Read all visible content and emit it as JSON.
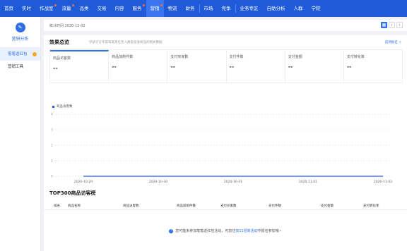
{
  "topnav": {
    "items": [
      {
        "label": "首页"
      },
      {
        "label": "实时"
      },
      {
        "label": "作战室",
        "dot": true
      },
      {
        "label": "流量",
        "dot": true
      },
      {
        "label": "品类"
      },
      {
        "label": "交易"
      },
      {
        "label": "内容"
      },
      {
        "label": "服务",
        "dot": true
      },
      {
        "label": "营销",
        "dot": true,
        "active": true
      },
      {
        "label": "物流"
      },
      {
        "label": "财务"
      },
      {
        "label": "市场"
      },
      {
        "label": "竞争"
      },
      {
        "label": "业务专区"
      },
      {
        "label": "自助分析"
      },
      {
        "label": "人群"
      },
      {
        "label": "学院"
      }
    ]
  },
  "sidebar": {
    "title": "营销分析",
    "items": [
      {
        "label": "笔笔返红包",
        "active": true
      },
      {
        "label": "营销工具"
      }
    ]
  },
  "datebar": {
    "text": "统计时间 2020-11-02"
  },
  "effect": {
    "title": "效果总览",
    "subtitle": "仅统计订作前笔笔现任务人群及投放商品的相关数据",
    "link": "选项报名 >",
    "metrics": [
      {
        "label": "商品访客数",
        "value": "--"
      },
      {
        "label": "商品加购件数",
        "value": "--"
      },
      {
        "label": "支付买家数",
        "value": "--"
      },
      {
        "label": "支付件数",
        "value": "--"
      },
      {
        "label": "支付金额",
        "value": "--"
      },
      {
        "label": "支付转化率",
        "value": "--"
      }
    ]
  },
  "chart_data": {
    "type": "line",
    "x": [
      "2020-10-29",
      "2020-10-30",
      "2020-10-31",
      "2020-11-01",
      "2020-11-02"
    ],
    "series": [
      {
        "name": "商品访客数",
        "values": [
          0,
          0,
          0,
          0,
          0
        ]
      }
    ],
    "yticks": [
      "0",
      "1",
      "2",
      "3",
      "4"
    ],
    "ylim": [
      0,
      4
    ],
    "grid": true,
    "legend": "top-left",
    "color": "#2f54eb"
  },
  "top300": {
    "title": "TOP300商品访客榜",
    "columns": [
      "排名",
      "商品名称",
      "商品访客数",
      "商品加购件数",
      "支付买家数",
      "支付件数",
      "支付金额",
      "支付转化率"
    ],
    "empty_prefix": "您可能未参加笔笔返红包活动，可前往",
    "empty_link": "双11招商活动",
    "empty_suffix": "中报名参加哦~"
  }
}
